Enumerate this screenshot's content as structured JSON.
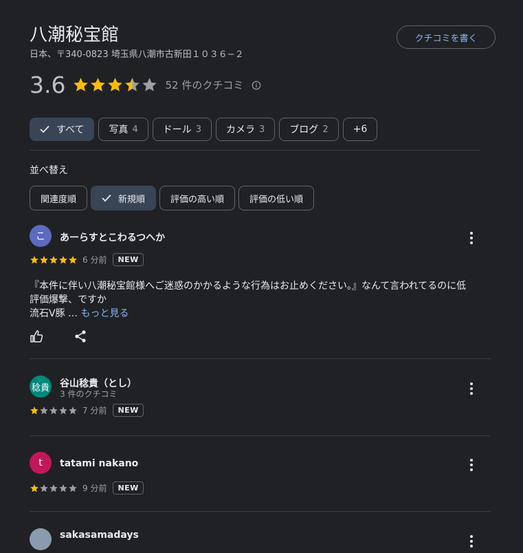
{
  "place": {
    "title": "八潮秘宝館",
    "address": "日本、〒340-0823 埼玉県八潮市古新田１０３６−２",
    "write_review_label": "クチコミを書く"
  },
  "summary": {
    "rating": "3.6",
    "rating_value": 3.6,
    "review_count_label": "52 件のクチコミ"
  },
  "filters": [
    {
      "label": "すべて",
      "count": "",
      "selected": true
    },
    {
      "label": "写真",
      "count": "4",
      "selected": false
    },
    {
      "label": "ドール",
      "count": "3",
      "selected": false
    },
    {
      "label": "カメラ",
      "count": "3",
      "selected": false
    },
    {
      "label": "ブログ",
      "count": "2",
      "selected": false
    },
    {
      "label": "+6",
      "count": "",
      "selected": false
    }
  ],
  "sort": {
    "label": "並べ替え",
    "options": [
      {
        "label": "関連度順",
        "selected": false
      },
      {
        "label": "新規順",
        "selected": true
      },
      {
        "label": "評価の高い順",
        "selected": false
      },
      {
        "label": "評価の低い順",
        "selected": false
      }
    ]
  },
  "reviews": [
    {
      "avatar_text": "こ",
      "avatar_color": "#5c6bc0",
      "name": "あーらすとこわるつへか",
      "sub": "",
      "stars": 5,
      "time": "6 分前",
      "badge": "NEW",
      "text_line1": "『本件に伴い八潮秘宝館様へご迷惑のかかるような行為はお止めください。』なんて言われてるのに低",
      "text_line2": "評価爆撃、ですか",
      "text_line3": "流石V豚 … ",
      "more_link": "もっと見る"
    },
    {
      "avatar_text": "稔貴",
      "avatar_color": "#00897b",
      "name": "谷山稔貴（とし）",
      "sub": "3 件のクチコミ",
      "stars": 1,
      "time": "7 分前",
      "badge": "NEW"
    },
    {
      "avatar_text": "t",
      "avatar_color": "#c2185b",
      "name": "tatami nakano",
      "sub": "",
      "stars": 1,
      "time": "9 分前",
      "badge": "NEW"
    },
    {
      "avatar_text": "",
      "avatar_color": "#8a9bb0",
      "name": "sakasamadays",
      "sub": ""
    }
  ],
  "colors": {
    "star_filled": "#fbbc04",
    "star_empty": "#9aa0a6",
    "link": "#8ab4f8"
  }
}
